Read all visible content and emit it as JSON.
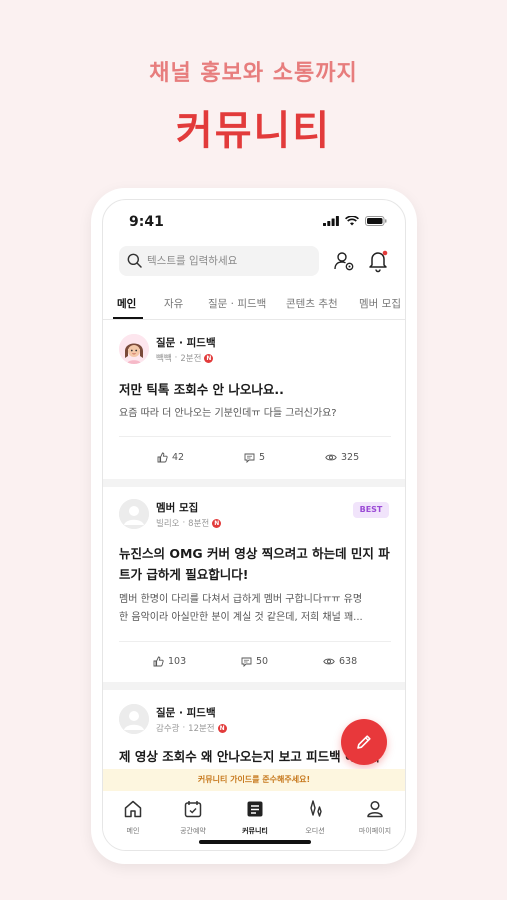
{
  "promo": {
    "subtitle": "채널 홍보와 소통까지",
    "title": "커뮤니티"
  },
  "status_bar": {
    "time": "9:41"
  },
  "search": {
    "placeholder": "텍스트를 입력하세요"
  },
  "tabs": [
    {
      "label": "메인",
      "active": true
    },
    {
      "label": "자유"
    },
    {
      "label": "질문 · 피드백"
    },
    {
      "label": "콘텐츠 추천"
    },
    {
      "label": "멤버 모집"
    }
  ],
  "posts": [
    {
      "category": "질문 · 피드백",
      "author": "빽빽",
      "time": "2분전",
      "new_mark": "N",
      "title": "저만 틱톡 조회수 안 나오나요..",
      "excerpt": "요즘 따라 더 안나오는 기분인데ㅠ 다들 그러신가요?",
      "likes": "42",
      "comments": "5",
      "views": "325"
    },
    {
      "category": "멤버 모집",
      "author": "빌리오",
      "time": "8분전",
      "new_mark": "N",
      "badge": "BEST",
      "title_line1": "뉴진스의 OMG 커버 영상 찍으려고 하는데 민지 파",
      "title_line2": "트가 급하게 필요합니다!",
      "excerpt_line1": "멤버 한명이 다리를 다쳐서 급하게 멤버 구합니다ㅠㅠ 유명",
      "excerpt_line2": "한 음악이라 아실만한 분이 계실 것 같은데, 저희 채널 꽤...",
      "likes": "103",
      "comments": "50",
      "views": "638"
    },
    {
      "category": "질문 · 피드백",
      "author": "감수광",
      "time": "12분전",
      "new_mark": "N",
      "title": "제 영상 조회수 왜 안나오는지 보고 피드백 해주세"
    }
  ],
  "guide_banner": "커뮤니티 가이드를 준수해주세요!",
  "bottom_nav": [
    {
      "label": "메인",
      "icon": "home-icon"
    },
    {
      "label": "공간예약",
      "icon": "calendar-icon"
    },
    {
      "label": "커뮤니티",
      "icon": "board-icon",
      "active": true
    },
    {
      "label": "오디션",
      "icon": "sparkle-icon"
    },
    {
      "label": "마이페이지",
      "icon": "person-icon"
    }
  ],
  "colors": {
    "background": "#fbf1f1",
    "brand_red": "#e23b3b",
    "promo_sub": "#e77d7d",
    "best_badge_bg": "#f1e4fb",
    "best_badge_text": "#9b4bd6",
    "guide_bg": "#fdf6df",
    "guide_text": "#c7791e"
  }
}
